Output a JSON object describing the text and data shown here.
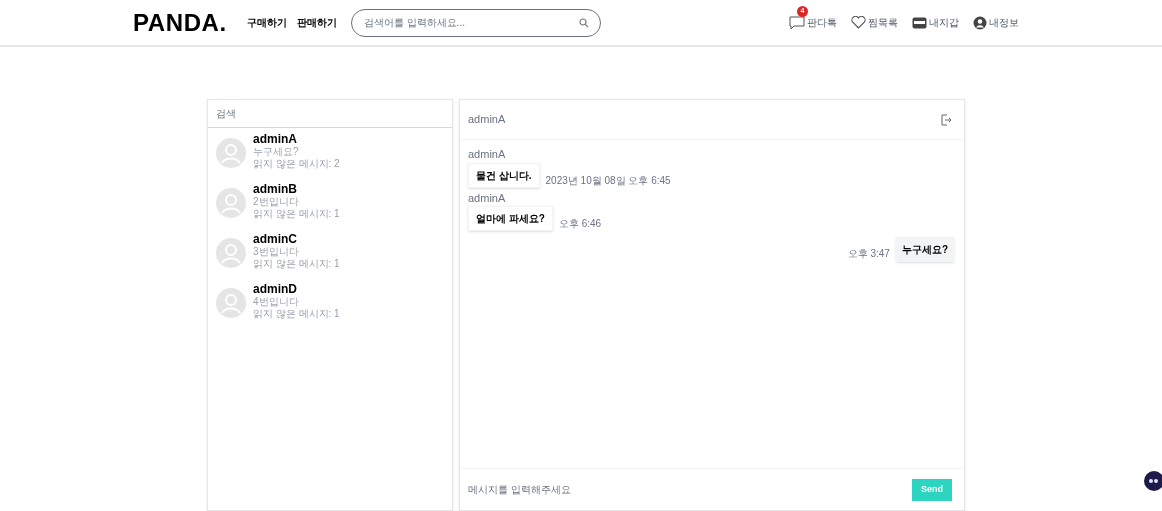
{
  "header": {
    "logo": "PANDA.",
    "nav": [
      "구매하기",
      "판매하기"
    ],
    "search": {
      "placeholder": "검색어를 입력하세요..."
    },
    "menu": [
      {
        "kind": "chat",
        "label": "판다톡",
        "badge": "4"
      },
      {
        "kind": "heart",
        "label": "찜목록"
      },
      {
        "kind": "wallet",
        "label": "내지갑"
      },
      {
        "kind": "user",
        "label": "내정보"
      }
    ]
  },
  "rooms_search": {
    "placeholder": "검색"
  },
  "rooms": [
    {
      "name": "adminA",
      "last_message": "누구세요?",
      "unread": "읽지 않은 메시지: 2"
    },
    {
      "name": "adminB",
      "last_message": "2번입니다",
      "unread": "읽지 않은 메시지: 1"
    },
    {
      "name": "adminC",
      "last_message": "3번입니다",
      "unread": "읽지 않은 메시지: 1"
    },
    {
      "name": "adminD",
      "last_message": "4번입니다",
      "unread": "읽지 않은 메시지: 1"
    }
  ],
  "chat": {
    "title": "adminA",
    "messages": [
      {
        "mine": false,
        "sender": "adminA",
        "text": "물건 삽니다.",
        "time": "2023년 10월 08일 오후 6:45"
      },
      {
        "mine": false,
        "sender": "adminA",
        "text": "얼마에 파세요?",
        "time": "오후 6:46"
      },
      {
        "mine": true,
        "text": "누구세요?",
        "time": "오후 3:47"
      }
    ],
    "input": {
      "placeholder": "메시지를 입력해주세요"
    },
    "send": "Send"
  }
}
